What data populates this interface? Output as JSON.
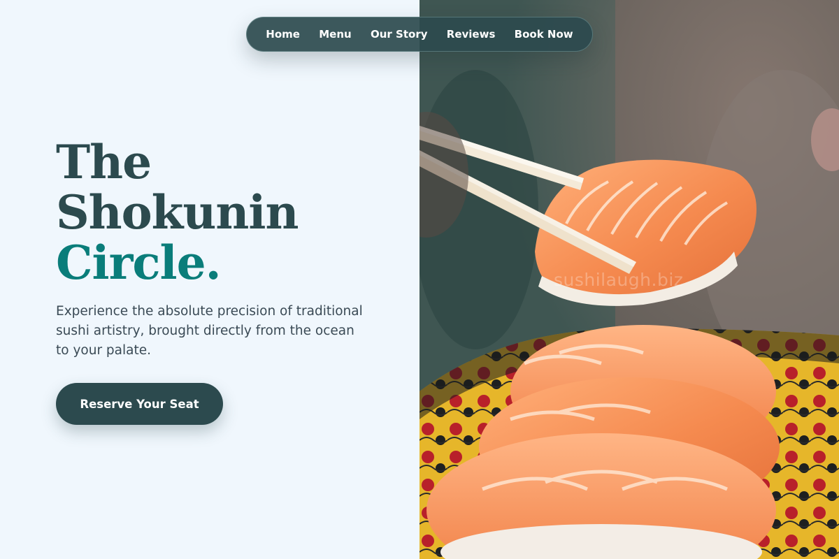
{
  "nav": {
    "items": [
      {
        "label": "Home"
      },
      {
        "label": "Menu"
      },
      {
        "label": "Our Story"
      },
      {
        "label": "Reviews"
      },
      {
        "label": "Book Now"
      }
    ]
  },
  "hero": {
    "title_line1": "The",
    "title_line2": "Shokunin",
    "title_line3": "Circle.",
    "description": "Experience the absolute precision of traditional sushi artistry, brought directly from the ocean to your palate.",
    "cta_label": "Reserve Your Seat"
  },
  "photo": {
    "watermark": "sushilaugh.biz"
  },
  "colors": {
    "background": "#f0f7fd",
    "primary": "#2c4a4e",
    "accent": "#0a7d7a",
    "body_text": "#3a4a55"
  }
}
